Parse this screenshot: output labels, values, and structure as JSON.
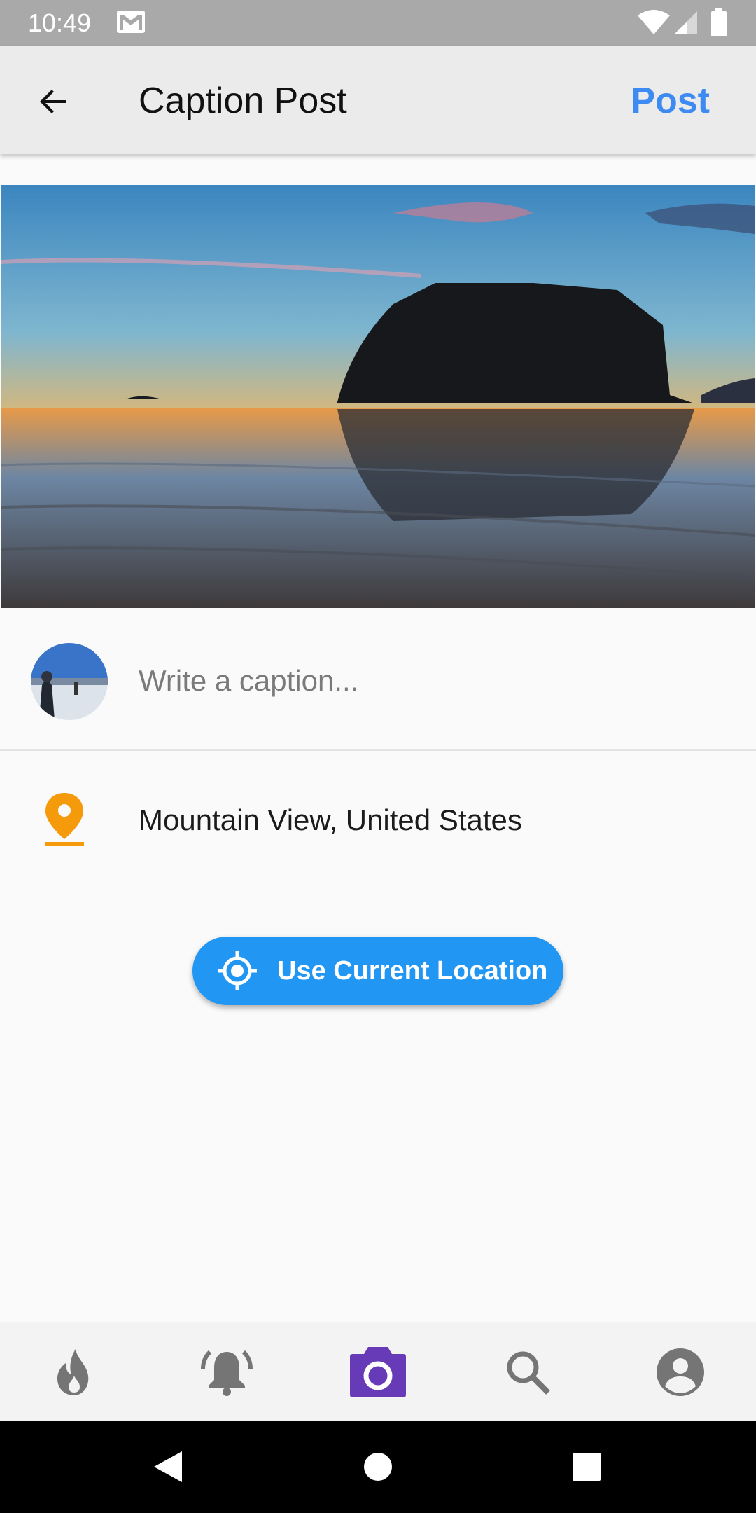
{
  "status_bar": {
    "time": "10:49"
  },
  "app_bar": {
    "title": "Caption Post",
    "post_label": "Post"
  },
  "caption": {
    "placeholder": "Write a caption...",
    "value": ""
  },
  "location": {
    "text": "Mountain View, United States"
  },
  "use_location_button": {
    "label": "Use Current Location"
  },
  "bottom_nav": {
    "items": [
      {
        "icon": "flame-icon",
        "active": false
      },
      {
        "icon": "bell-ringing-icon",
        "active": false
      },
      {
        "icon": "camera-icon",
        "active": true
      },
      {
        "icon": "search-icon",
        "active": false
      },
      {
        "icon": "account-icon",
        "active": false
      }
    ]
  },
  "colors": {
    "accent": "#3d8bf2",
    "button_blue": "#2196f3",
    "location_orange": "#f59a0b",
    "active_nav": "#673ab7",
    "inactive_nav": "#757575"
  }
}
